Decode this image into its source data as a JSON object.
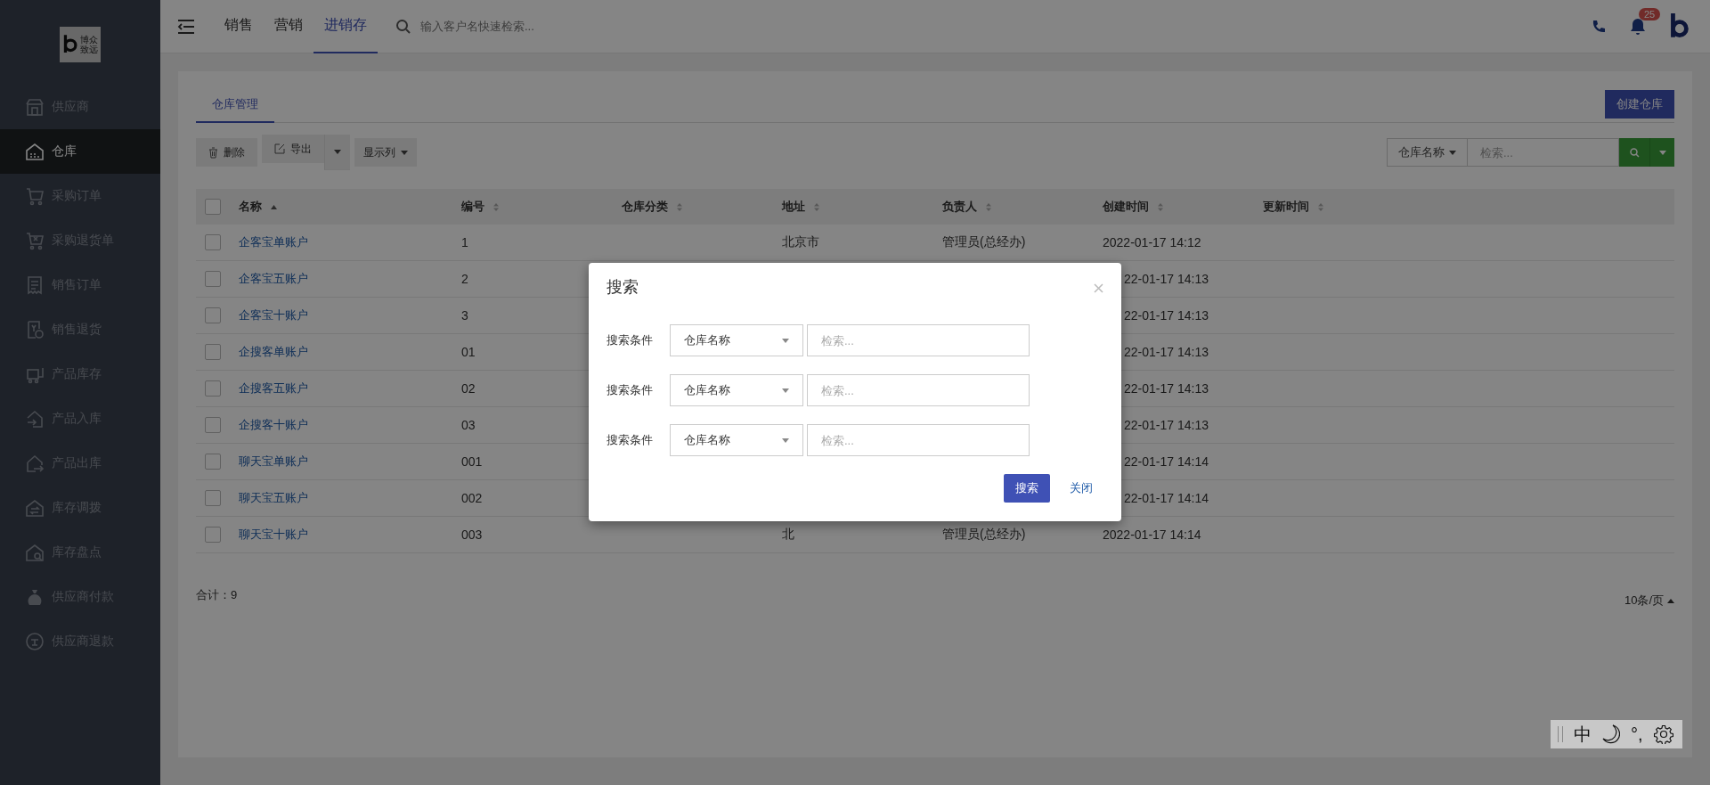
{
  "sidebar": {
    "logo_text": "博众致远",
    "items": [
      {
        "label": "供应商",
        "selected": false
      },
      {
        "label": "仓库",
        "selected": true
      },
      {
        "label": "采购订单",
        "selected": false
      },
      {
        "label": "采购退货单",
        "selected": false
      },
      {
        "label": "销售订单",
        "selected": false
      },
      {
        "label": "销售退货",
        "selected": false
      },
      {
        "label": "产品库存",
        "selected": false
      },
      {
        "label": "产品入库",
        "selected": false
      },
      {
        "label": "产品出库",
        "selected": false
      },
      {
        "label": "库存调拨",
        "selected": false
      },
      {
        "label": "库存盘点",
        "selected": false
      },
      {
        "label": "供应商付款",
        "selected": false
      },
      {
        "label": "供应商退款",
        "selected": false
      }
    ]
  },
  "topbar": {
    "tabs": [
      {
        "label": "销售",
        "selected": false
      },
      {
        "label": "营销",
        "selected": false
      },
      {
        "label": "进销存",
        "selected": true
      }
    ],
    "search": {
      "placeholder": "输入客户名快速检索..."
    },
    "notification_count": "25"
  },
  "page": {
    "tabs": [
      {
        "label": "仓库管理",
        "selected": true
      }
    ],
    "create_button": "创建仓库",
    "toolbar": [
      {
        "label": "删除",
        "kind": "plain"
      },
      {
        "label": "导出",
        "kind": "split"
      },
      {
        "label": "显示列",
        "kind": "dropdown"
      }
    ],
    "filter": {
      "field": "仓库名称",
      "placeholder": "检索..."
    },
    "table": {
      "select_all_checked": false,
      "columns": [
        {
          "label": "名称",
          "sorted": true
        },
        {
          "label": "编号",
          "sorted": false
        },
        {
          "label": "仓库分类",
          "sorted": false
        },
        {
          "label": "地址",
          "sorted": false
        },
        {
          "label": "负责人",
          "sorted": false
        },
        {
          "label": "创建时间",
          "sorted": false
        },
        {
          "label": "更新时间",
          "sorted": false
        }
      ],
      "rows": [
        {
          "checked": false,
          "name": "企客宝单账户",
          "code": "1",
          "address": "北京市",
          "manager": "管理员(总经办)",
          "created": "2022-01-17 14:12"
        },
        {
          "checked": false,
          "name": "企客宝五账户",
          "code": "2",
          "created": "22-01-17 14:13"
        },
        {
          "checked": false,
          "name": "企客宝十账户",
          "code": "3",
          "created": "22-01-17 14:13"
        },
        {
          "checked": false,
          "name": "企搜客单账户",
          "code": "01",
          "created": "22-01-17 14:13"
        },
        {
          "checked": false,
          "name": "企搜客五账户",
          "code": "02",
          "created": "22-01-17 14:13"
        },
        {
          "checked": false,
          "name": "企搜客十账户",
          "code": "03",
          "created": "22-01-17 14:13"
        },
        {
          "checked": false,
          "name": "聊天宝单账户",
          "code": "001",
          "created": "22-01-17 14:14"
        },
        {
          "checked": false,
          "name": "聊天宝五账户",
          "code": "002",
          "created": "22-01-17 14:14"
        },
        {
          "checked": false,
          "name": "聊天宝十账户",
          "code": "003",
          "address": "北",
          "manager": "管理员(总经办)",
          "created": "2022-01-17 14:14"
        }
      ]
    },
    "total": "合计：9",
    "page_size": "10条/页"
  },
  "dialog": {
    "title": "搜索",
    "conditions": [
      {
        "label": "搜索条件",
        "field": "仓库名称",
        "placeholder": "检索..."
      },
      {
        "label": "搜索条件",
        "field": "仓库名称",
        "placeholder": "检索..."
      },
      {
        "label": "搜索条件",
        "field": "仓库名称",
        "placeholder": "检索..."
      }
    ],
    "buttons": [
      {
        "label": "搜索",
        "kind": "primary"
      },
      {
        "label": "关闭",
        "kind": "link"
      }
    ]
  },
  "ime_bar": {
    "items": [
      {
        "kind": "text",
        "label": "中"
      },
      {
        "kind": "moon"
      },
      {
        "kind": "text",
        "label": "°,"
      },
      {
        "kind": "gear"
      }
    ]
  }
}
